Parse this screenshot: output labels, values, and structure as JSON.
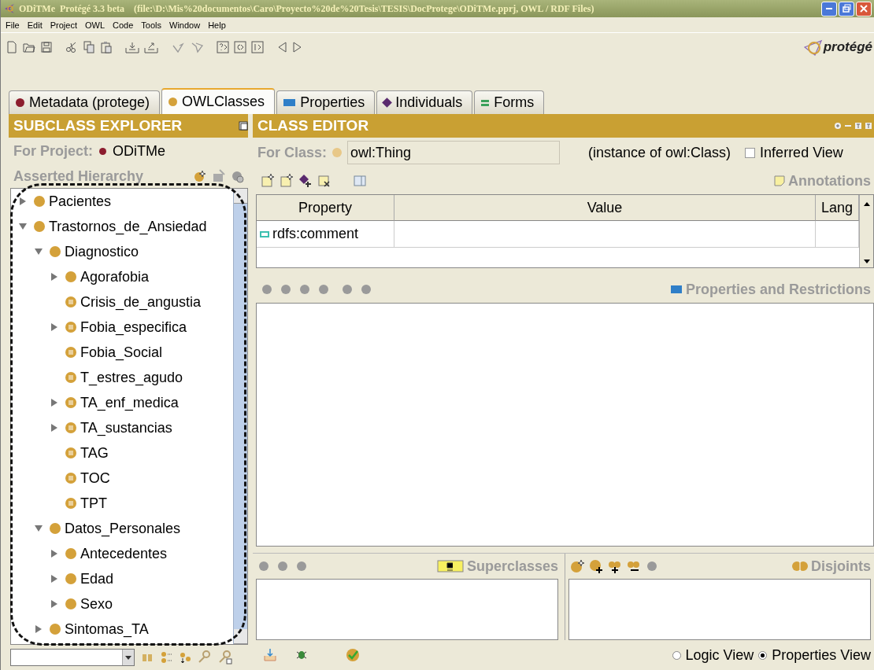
{
  "window": {
    "title": "ODiTMe  Protégé 3.3 beta    (file:\\D:\\Mis%20documentos\\Caro\\Proyecto%20de%20Tesis\\TESIS\\DocProtege\\ODiTMe.pprj, OWL / RDF Files)"
  },
  "menu": [
    "File",
    "Edit",
    "Project",
    "OWL",
    "Code",
    "Tools",
    "Window",
    "Help"
  ],
  "logo": {
    "text": "protégé"
  },
  "tabs": [
    {
      "label": "Metadata (protege)",
      "selected": false,
      "kind": "dot",
      "color": "#8c1d2e"
    },
    {
      "label": "OWLClasses",
      "selected": true,
      "kind": "dot",
      "color": "#d4a13a"
    },
    {
      "label": "Properties",
      "selected": false,
      "kind": "bar",
      "color": "#2f7fc8"
    },
    {
      "label": "Individuals",
      "selected": false,
      "kind": "diamond",
      "color": "#5a2a6e"
    },
    {
      "label": "Forms",
      "selected": false,
      "kind": "equals",
      "color": "#3aa05a"
    }
  ],
  "subclass_explorer": {
    "title": "SUBCLASS EXPLORER",
    "project_label": "For Project:",
    "project_name": "ODiTMe",
    "hierarchy_label": "Asserted Hierarchy",
    "tree": [
      {
        "label": "Pacientes",
        "expandable": true,
        "expanded": false,
        "defined": false
      },
      {
        "label": "Trastornos_de_Ansiedad",
        "expandable": true,
        "expanded": true,
        "defined": false,
        "children": [
          {
            "label": "Diagnostico",
            "expandable": true,
            "expanded": true,
            "defined": false,
            "children": [
              {
                "label": "Agorafobia",
                "expandable": true,
                "expanded": false,
                "defined": false
              },
              {
                "label": "Crisis_de_angustia",
                "expandable": false,
                "defined": true
              },
              {
                "label": "Fobia_especifica",
                "expandable": true,
                "expanded": false,
                "defined": true
              },
              {
                "label": "Fobia_Social",
                "expandable": false,
                "defined": true
              },
              {
                "label": "T_estres_agudo",
                "expandable": false,
                "defined": true
              },
              {
                "label": "TA_enf_medica",
                "expandable": true,
                "expanded": false,
                "defined": true
              },
              {
                "label": "TA_sustancias",
                "expandable": true,
                "expanded": false,
                "defined": true
              },
              {
                "label": "TAG",
                "expandable": false,
                "defined": true
              },
              {
                "label": "TOC",
                "expandable": false,
                "defined": true
              },
              {
                "label": "TPT",
                "expandable": false,
                "defined": true
              }
            ]
          },
          {
            "label": "Datos_Personales",
            "expandable": true,
            "expanded": true,
            "defined": false,
            "children": [
              {
                "label": "Antecedentes",
                "expandable": true,
                "expanded": false,
                "defined": false
              },
              {
                "label": "Edad",
                "expandable": true,
                "expanded": false,
                "defined": false
              },
              {
                "label": "Sexo",
                "expandable": true,
                "expanded": false,
                "defined": false
              }
            ]
          },
          {
            "label": "Sintomas_TA",
            "expandable": true,
            "expanded": false,
            "defined": false
          }
        ]
      }
    ]
  },
  "class_editor": {
    "title": "CLASS EDITOR",
    "class_label": "For Class:",
    "class_value": "owl:Thing",
    "instance_of": "(instance of owl:Class)",
    "inferred_view": {
      "label": "Inferred View",
      "checked": false
    },
    "annotations_label": "Annotations",
    "table": {
      "columns": [
        "Property",
        "Value",
        "Lang"
      ],
      "rows": [
        {
          "property": "rdfs:comment"
        }
      ]
    },
    "properties_label": "Properties and Restrictions",
    "superclasses_label": "Superclasses",
    "disjoints_label": "Disjoints",
    "views": [
      {
        "label": "Logic View",
        "selected": false
      },
      {
        "label": "Properties View",
        "selected": true
      }
    ]
  }
}
